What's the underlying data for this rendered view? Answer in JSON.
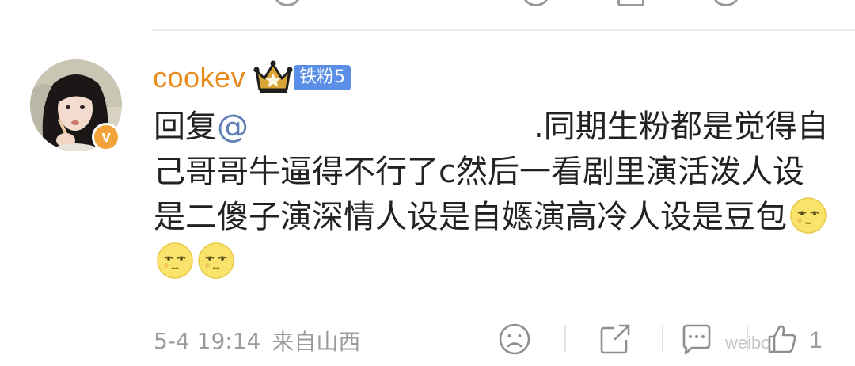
{
  "comment": {
    "username": "cookev",
    "fan_badge": "铁粉5",
    "verified_badge": "v",
    "content": {
      "prefix": "回复",
      "mention": "@",
      "text": ".同期生粉都是觉得自己哥哥牛逼得不行了c然后一看剧里演活泼人设是二傻子演深情人设是自嫕演高冷人设是豆包",
      "emojis": [
        "moon-face",
        "moon-face",
        "moon-face"
      ]
    },
    "timestamp": "5-4 19:14",
    "source": "来自山西",
    "like_count": "1",
    "watermark": "weibo"
  },
  "icons": {
    "avatar": "avatar-photo",
    "crown": "crown-icon",
    "dislike": "sad-face-icon",
    "share": "share-icon",
    "reply": "comment-icon",
    "like": "thumbs-up-icon"
  },
  "colors": {
    "username": "#ea8a1c",
    "fan_badge_bg": "#5b8ee6",
    "mention": "#5d7fb6",
    "verified_badge": "#f2a238",
    "meta_text": "#9b9b9b"
  }
}
